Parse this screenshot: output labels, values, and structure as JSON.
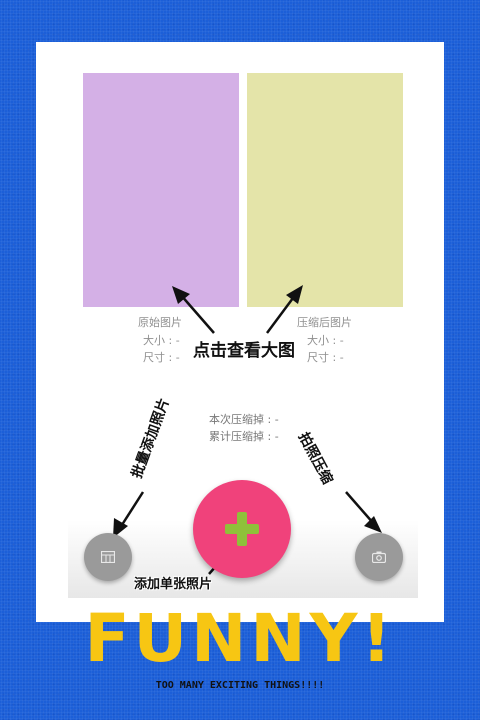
{
  "images": {
    "original_color": "#d4b0e6",
    "compressed_color": "#e4e4a9"
  },
  "original": {
    "title": "原始图片",
    "size_label": "大小 : -",
    "dim_label": "尺寸 : -"
  },
  "compressed": {
    "title": "压缩后图片",
    "size_label": "大小 : -",
    "dim_label": "尺寸 : -"
  },
  "stats": {
    "this_rate": "本次压缩掉 : -",
    "total_rate": "累计压缩掉 : -"
  },
  "annotations": {
    "view_large": "点击查看大图",
    "batch_add": "批量添加照片",
    "photo_compress": "拍照压缩",
    "add_single": "添加单张照片"
  },
  "buttons": {
    "batch_icon": "gallery-icon",
    "add_icon": "plus-icon",
    "camera_icon": "camera-icon",
    "accent_color": "#f0427b"
  },
  "promo": {
    "headline": "FUNNY!",
    "tagline": "TOO MANY EXCITING THINGS!!!!"
  }
}
